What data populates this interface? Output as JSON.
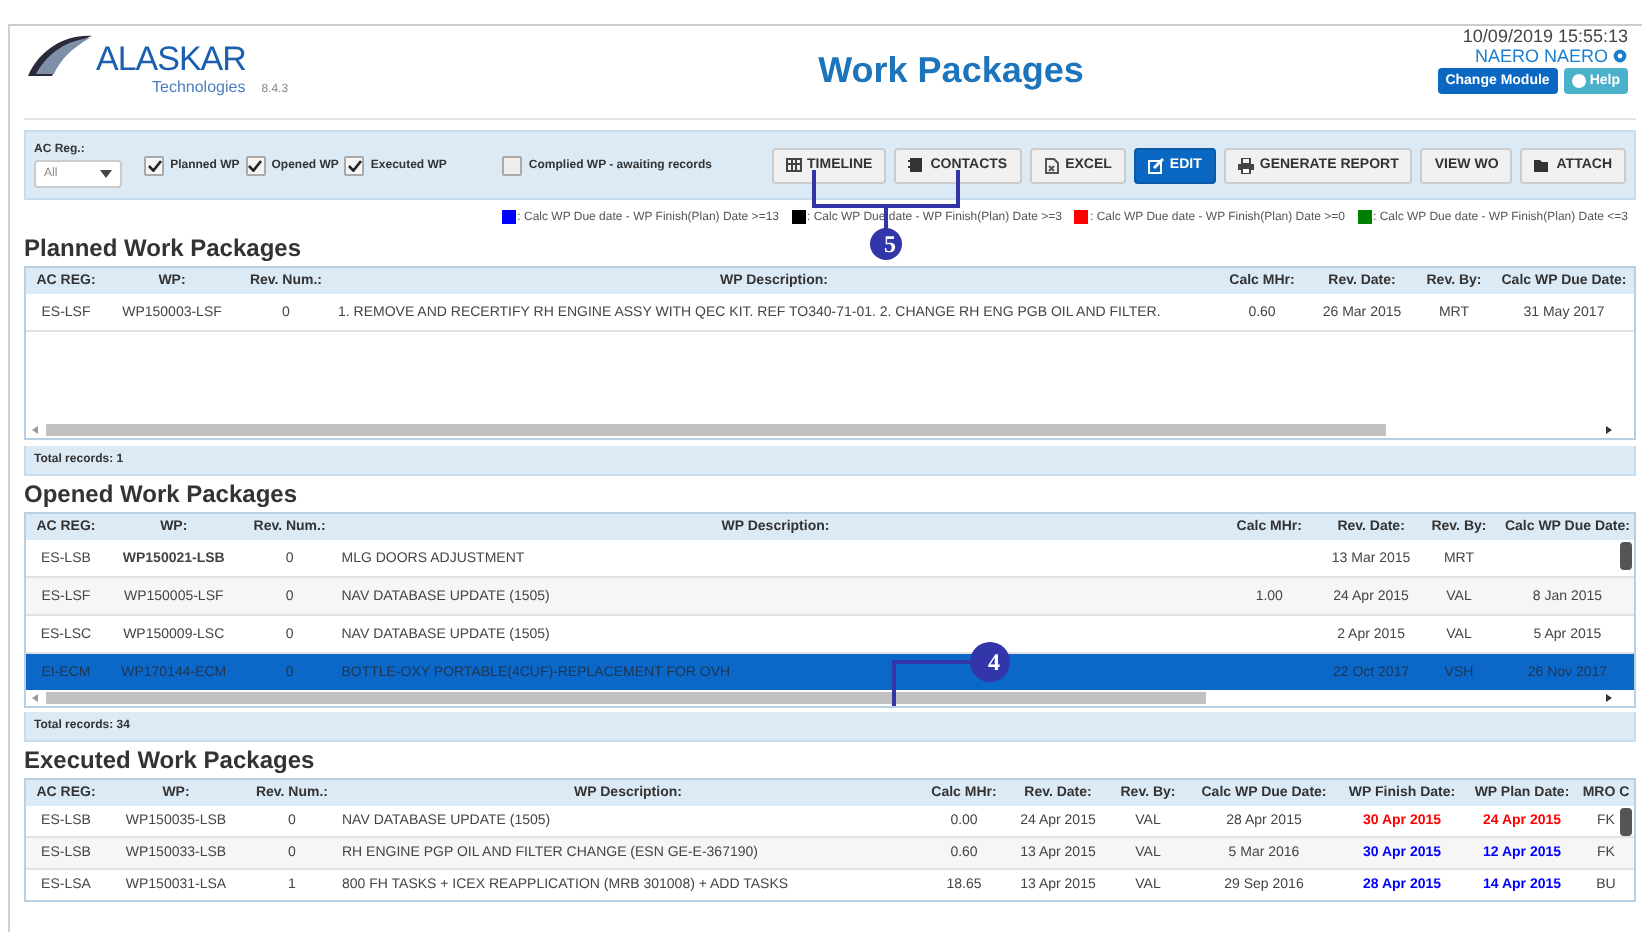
{
  "header": {
    "brand": "ALASKAR",
    "subbrand": "Technologies",
    "version": "8.4.3",
    "title": "Work Packages",
    "datetime": "10/09/2019 15:55:13",
    "user": "NAERO NAERO",
    "buttons": [
      {
        "label": "Change Module",
        "kind": "primary"
      },
      {
        "label": "Help",
        "kind": "info"
      }
    ]
  },
  "filters": {
    "ac_reg_label": "AC Reg.:",
    "ac_reg_value": "All",
    "checkboxes": [
      {
        "label": "Planned WP",
        "checked": true
      },
      {
        "label": "Opened WP",
        "checked": true
      },
      {
        "label": "Executed WP",
        "checked": true
      },
      {
        "label": "Complied WP - awaiting records",
        "checked": false
      }
    ],
    "buttons": [
      {
        "label": "TIMELINE",
        "kind": "default"
      },
      {
        "label": "CONTACTS",
        "kind": "default"
      },
      {
        "label": "EXCEL",
        "kind": "default"
      },
      {
        "label": "EDIT",
        "kind": "primary"
      },
      {
        "label": "GENERATE REPORT",
        "kind": "default"
      },
      {
        "label": "VIEW WO",
        "kind": "default"
      },
      {
        "label": "ATTACH",
        "kind": "default"
      }
    ]
  },
  "legend": [
    {
      "color": "#0000ff",
      "label": ": Calc WP Due date - WP Finish(Plan) Date >=13"
    },
    {
      "color": "#000000",
      "label": ": Calc WP Due date - WP Finish(Plan) Date >=3"
    },
    {
      "color": "#ff0000",
      "label": ": Calc WP Due date - WP Finish(Plan) Date >=0"
    },
    {
      "color": "#008000",
      "label": ": Calc WP Due date - WP Finish(Plan) Date <=3"
    }
  ],
  "sections": [
    {
      "title": "Planned Work Packages",
      "total": "Total records: 1",
      "columns": [
        {
          "label": "AC REG:"
        },
        {
          "label": "WP:"
        },
        {
          "label": "Rev. Num.:"
        },
        {
          "label": "WP Description:"
        },
        {
          "label": "Calc MHr:"
        },
        {
          "label": "Rev. Date:"
        },
        {
          "label": "Rev. By:"
        },
        {
          "label": "Calc WP Due Date:"
        }
      ],
      "rows": [
        {
          "selected": false,
          "cells": [
            "ES-LSF",
            "WP150003-LSF",
            "0",
            "1. REMOVE AND RECERTIFY RH ENGINE ASSY WITH QEC KIT. REF TO340-71-01. 2. CHANGE RH ENG PGB OIL AND FILTER.",
            "0.60",
            "26 Mar 2015",
            "MRT",
            "31 May 2017"
          ]
        }
      ]
    },
    {
      "title": "Opened Work Packages",
      "total": "Total records: 34",
      "columns": [
        {
          "label": "AC REG:"
        },
        {
          "label": "WP:"
        },
        {
          "label": "Rev. Num.:"
        },
        {
          "label": "WP Description:"
        },
        {
          "label": "Calc MHr:"
        },
        {
          "label": "Rev. Date:"
        },
        {
          "label": "Rev. By:"
        },
        {
          "label": "Calc WP Due Date:"
        }
      ],
      "rows": [
        {
          "selected": false,
          "wp_bold": true,
          "cells": [
            "ES-LSB",
            "WP150021-LSB",
            "0",
            "MLG DOORS ADJUSTMENT",
            "",
            "13 Mar 2015",
            "MRT",
            ""
          ]
        },
        {
          "selected": false,
          "cells": [
            "ES-LSF",
            "WP150005-LSF",
            "0",
            "NAV DATABASE UPDATE (1505)",
            "1.00",
            "24 Apr 2015",
            "VAL",
            "8 Jan 2015"
          ]
        },
        {
          "selected": false,
          "cells": [
            "ES-LSC",
            "WP150009-LSC",
            "0",
            "NAV DATABASE UPDATE (1505)",
            "",
            "2 Apr 2015",
            "VAL",
            "5 Apr 2015"
          ]
        },
        {
          "selected": true,
          "cells": [
            "EI-ECM",
            "WP170144-ECM",
            "0",
            "BOTTLE-OXY PORTABLE(4CUF)-REPLACEMENT FOR OVH",
            "",
            "22 Oct 2017",
            "VSH",
            "26 Nov 2017"
          ]
        }
      ]
    },
    {
      "title": "Executed Work Packages",
      "columns": [
        {
          "label": "AC REG:"
        },
        {
          "label": "WP:"
        },
        {
          "label": "Rev. Num.:"
        },
        {
          "label": "WP Description:"
        },
        {
          "label": "Calc MHr:"
        },
        {
          "label": "Rev. Date:"
        },
        {
          "label": "Rev. By:"
        },
        {
          "label": "Calc WP Due Date:"
        },
        {
          "label": "WP Finish Date:"
        },
        {
          "label": "WP Plan Date:"
        },
        {
          "label": "MRO C"
        }
      ],
      "rows": [
        {
          "selected": false,
          "color": "#ff0000",
          "cells": [
            "ES-LSB",
            "WP150035-LSB",
            "0",
            "NAV DATABASE UPDATE (1505)",
            "0.00",
            "24 Apr 2015",
            "VAL",
            "28 Apr 2015",
            "30 Apr 2015",
            "24 Apr 2015",
            "FK"
          ]
        },
        {
          "selected": false,
          "color": "#0000ff",
          "cells": [
            "ES-LSB",
            "WP150033-LSB",
            "0",
            "RH ENGINE PGP OIL AND FILTER CHANGE (ESN GE-E-367190)",
            "0.60",
            "13 Apr 2015",
            "VAL",
            "5 Mar 2016",
            "30 Apr 2015",
            "12 Apr 2015",
            "FK"
          ]
        },
        {
          "selected": false,
          "color": "#0000ff",
          "cells": [
            "ES-LSA",
            "WP150031-LSA",
            "1",
            "800 FH TASKS + ICEX REAPPLICATION (MRB 301008) + ADD TASKS",
            "18.65",
            "13 Apr 2015",
            "VAL",
            "29 Sep 2016",
            "28 Apr 2015",
            "14 Apr 2015",
            "BU"
          ]
        }
      ]
    }
  ],
  "callouts": [
    {
      "label": "5"
    },
    {
      "label": "4"
    }
  ]
}
